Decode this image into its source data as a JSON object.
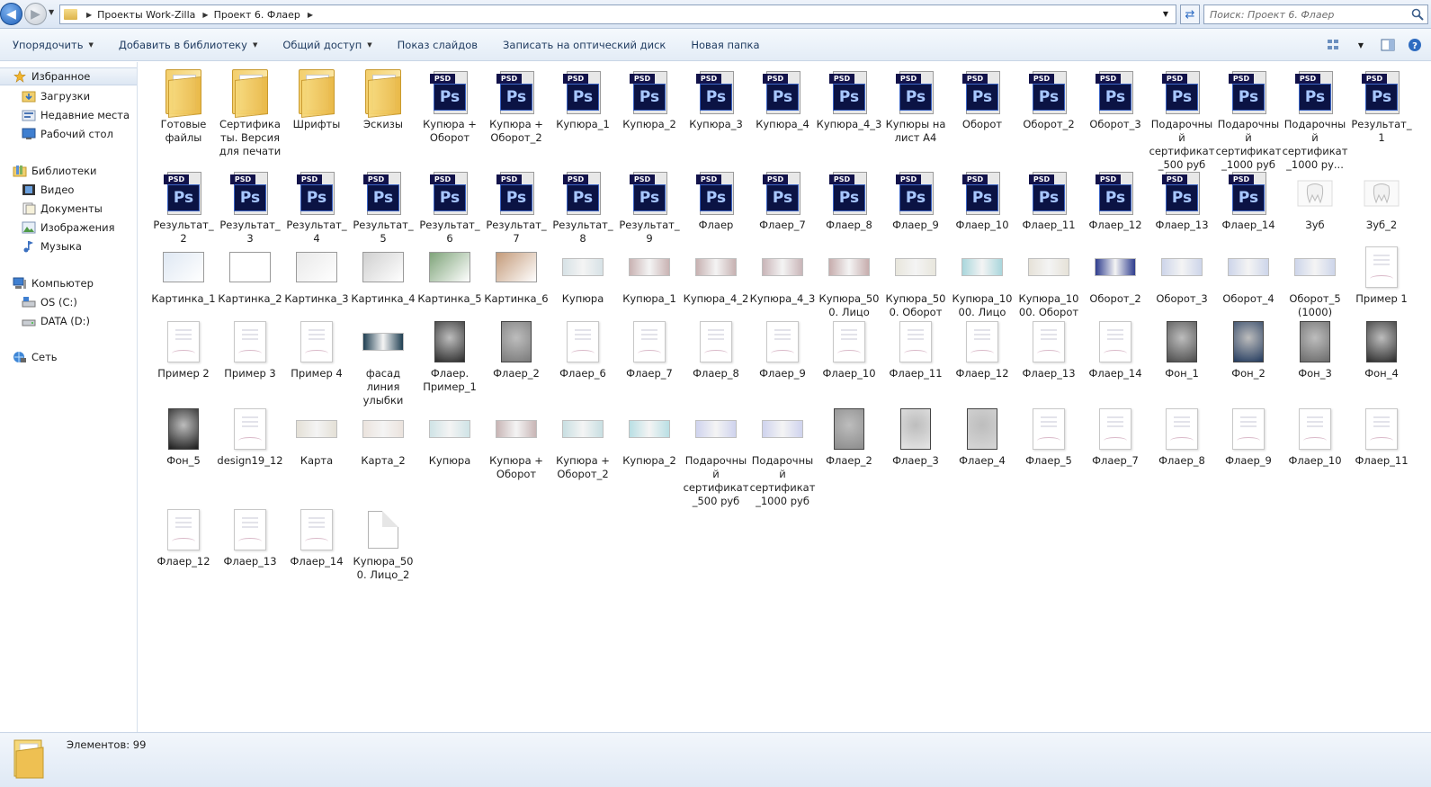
{
  "address": {
    "crumbs": [
      "Проекты Work-Zilla",
      "Проект 6. Флаер"
    ],
    "search_placeholder": "Поиск: Проект 6. Флаер"
  },
  "toolbar": {
    "organize": "Упорядочить",
    "add_to_library": "Добавить в библиотеку",
    "share": "Общий доступ",
    "slideshow": "Показ слайдов",
    "burn": "Записать на оптический диск",
    "new_folder": "Новая папка"
  },
  "nav": {
    "favorites": "Избранное",
    "downloads": "Загрузки",
    "recent": "Недавние места",
    "desktop": "Рабочий стол",
    "libraries": "Библиотеки",
    "video": "Видео",
    "documents": "Документы",
    "images": "Изображения",
    "music": "Музыка",
    "computer": "Компьютер",
    "os_c": "OS (C:)",
    "data_d": "DATA (D:)",
    "network": "Сеть"
  },
  "files": [
    {
      "name": "Готовые файлы",
      "kind": "folder"
    },
    {
      "name": "Сертификаты. Версия для печати",
      "kind": "folder"
    },
    {
      "name": "Шрифты",
      "kind": "folder"
    },
    {
      "name": "Эскизы",
      "kind": "folder"
    },
    {
      "name": "Купюра + Оборот",
      "kind": "psd"
    },
    {
      "name": "Купюра + Оборот_2",
      "kind": "psd"
    },
    {
      "name": "Купюра_1",
      "kind": "psd"
    },
    {
      "name": "Купюра_2",
      "kind": "psd"
    },
    {
      "name": "Купюра_3",
      "kind": "psd"
    },
    {
      "name": "Купюра_4",
      "kind": "psd"
    },
    {
      "name": "Купюра_4_3",
      "kind": "psd"
    },
    {
      "name": "Купюры на лист А4",
      "kind": "psd"
    },
    {
      "name": "Оборот",
      "kind": "psd"
    },
    {
      "name": "Оборот_2",
      "kind": "psd"
    },
    {
      "name": "Оборот_3",
      "kind": "psd"
    },
    {
      "name": "Подарочный сертификат_500 руб",
      "kind": "psd"
    },
    {
      "name": "Подарочный сертификат_1000 руб",
      "kind": "psd"
    },
    {
      "name": "Подарочный сертификат_1000 ру...",
      "kind": "psd"
    },
    {
      "name": "Результат_1",
      "kind": "psd"
    },
    {
      "name": "Результат_2",
      "kind": "psd"
    },
    {
      "name": "Результат_3",
      "kind": "psd"
    },
    {
      "name": "Результат_4",
      "kind": "psd"
    },
    {
      "name": "Результат_5",
      "kind": "psd"
    },
    {
      "name": "Результат_6",
      "kind": "psd"
    },
    {
      "name": "Результат_7",
      "kind": "psd"
    },
    {
      "name": "Результат_8",
      "kind": "psd"
    },
    {
      "name": "Результат_9",
      "kind": "psd"
    },
    {
      "name": "Флаер",
      "kind": "psd"
    },
    {
      "name": "Флаер_7",
      "kind": "psd"
    },
    {
      "name": "Флаер_8",
      "kind": "psd"
    },
    {
      "name": "Флаер_9",
      "kind": "psd"
    },
    {
      "name": "Флаер_10",
      "kind": "psd"
    },
    {
      "name": "Флаер_11",
      "kind": "psd"
    },
    {
      "name": "Флаер_12",
      "kind": "psd"
    },
    {
      "name": "Флаер_13",
      "kind": "psd"
    },
    {
      "name": "Флаер_14",
      "kind": "psd"
    },
    {
      "name": "Зуб",
      "kind": "tooth"
    },
    {
      "name": "Зуб_2",
      "kind": "tooth"
    },
    {
      "name": "Картинка_1",
      "kind": "photo",
      "color": "#dfe8f3"
    },
    {
      "name": "Картинка_2",
      "kind": "photo",
      "color": "#ffffff"
    },
    {
      "name": "Картинка_3",
      "kind": "photo",
      "color": "#e9e9e9"
    },
    {
      "name": "Картинка_4",
      "kind": "photo",
      "color": "#d0d0d0"
    },
    {
      "name": "Картинка_5",
      "kind": "photo",
      "color": "#7fa47a"
    },
    {
      "name": "Картинка_6",
      "kind": "photo",
      "color": "#c49b7a"
    },
    {
      "name": "Купюра",
      "kind": "land",
      "color": "#d7e2e6"
    },
    {
      "name": "Купюра_1",
      "kind": "land",
      "color": "#c9b3b3"
    },
    {
      "name": "Купюра_4_2",
      "kind": "land",
      "color": "#c7b1b1"
    },
    {
      "name": "Купюра_4_3",
      "kind": "land",
      "color": "#c9b5b8"
    },
    {
      "name": "Купюра_500. Лицо",
      "kind": "land",
      "color": "#c7adad"
    },
    {
      "name": "Купюра_500. Оборот",
      "kind": "land",
      "color": "#e8e6dc"
    },
    {
      "name": "Купюра_1000. Лицо",
      "kind": "land",
      "color": "#a9d6dc"
    },
    {
      "name": "Купюра_1000. Оборот",
      "kind": "land",
      "color": "#e6e2d8"
    },
    {
      "name": "Оборот_2",
      "kind": "land",
      "color": "#2f3d8e"
    },
    {
      "name": "Оборот_3",
      "kind": "land",
      "color": "#cdd5ea"
    },
    {
      "name": "Оборот_4",
      "kind": "land",
      "color": "#cdd5ea"
    },
    {
      "name": "Оборот_5 (1000)",
      "kind": "land",
      "color": "#cdd5ea"
    },
    {
      "name": "Пример 1",
      "kind": "doc"
    },
    {
      "name": "Пример 2",
      "kind": "doc"
    },
    {
      "name": "Пример 3",
      "kind": "doc"
    },
    {
      "name": "Пример 4",
      "kind": "doc"
    },
    {
      "name": "фасад линия улыбки",
      "kind": "land",
      "color": "#1f3f52"
    },
    {
      "name": "Флаер. Пример_1",
      "kind": "dark",
      "color": "#2b2b2b"
    },
    {
      "name": "Флаер_2",
      "kind": "dark",
      "color": "#7a7a7a"
    },
    {
      "name": "Флаер_6",
      "kind": "doc"
    },
    {
      "name": "Флаер_7",
      "kind": "doc"
    },
    {
      "name": "Флаер_8",
      "kind": "doc"
    },
    {
      "name": "Флаер_9",
      "kind": "doc"
    },
    {
      "name": "Флаер_10",
      "kind": "doc"
    },
    {
      "name": "Флаер_11",
      "kind": "doc"
    },
    {
      "name": "Флаер_12",
      "kind": "doc"
    },
    {
      "name": "Флаер_13",
      "kind": "doc"
    },
    {
      "name": "Флаер_14",
      "kind": "doc"
    },
    {
      "name": "Фон_1",
      "kind": "dark",
      "color": "#4b4b4b"
    },
    {
      "name": "Фон_2",
      "kind": "dark",
      "color": "#223a5e"
    },
    {
      "name": "Фон_3",
      "kind": "dark",
      "color": "#6a6a6a"
    },
    {
      "name": "Фон_4",
      "kind": "dark",
      "color": "#2c2c2c"
    },
    {
      "name": "Фон_5",
      "kind": "dark",
      "color": "#1a1a1a"
    },
    {
      "name": "design19_12",
      "kind": "doc"
    },
    {
      "name": "Карта",
      "kind": "land",
      "color": "#e4e0d6"
    },
    {
      "name": "Карта_2",
      "kind": "land",
      "color": "#ebe3dd"
    },
    {
      "name": "Купюра",
      "kind": "land",
      "color": "#cfe3e6"
    },
    {
      "name": "Купюра + Оборот",
      "kind": "land",
      "color": "#c8b5b5"
    },
    {
      "name": "Купюра + Оборот_2",
      "kind": "land",
      "color": "#c8dfe2"
    },
    {
      "name": "Купюра_2",
      "kind": "land",
      "color": "#b9dfe4"
    },
    {
      "name": "Подарочный сертификат_500 руб",
      "kind": "land",
      "color": "#cfd3ee"
    },
    {
      "name": "Подарочный сертификат_1000 руб",
      "kind": "land",
      "color": "#cfd3ee"
    },
    {
      "name": "Флаер_2",
      "kind": "dark",
      "color": "#8c8c8c"
    },
    {
      "name": "Флаер_3",
      "kind": "dark",
      "color": "#e5e5e5"
    },
    {
      "name": "Флаер_4",
      "kind": "dark",
      "color": "#d6d6d6"
    },
    {
      "name": "Флаер_5",
      "kind": "doc"
    },
    {
      "name": "Флаер_7",
      "kind": "doc"
    },
    {
      "name": "Флаер_8",
      "kind": "doc"
    },
    {
      "name": "Флаер_9",
      "kind": "doc"
    },
    {
      "name": "Флаер_10",
      "kind": "doc"
    },
    {
      "name": "Флаер_11",
      "kind": "doc"
    },
    {
      "name": "Флаер_12",
      "kind": "doc"
    },
    {
      "name": "Флаер_13",
      "kind": "doc"
    },
    {
      "name": "Флаер_14",
      "kind": "doc"
    },
    {
      "name": "Купюра_500. Лицо_2",
      "kind": "blank"
    }
  ],
  "status": {
    "count": "Элементов: 99"
  }
}
